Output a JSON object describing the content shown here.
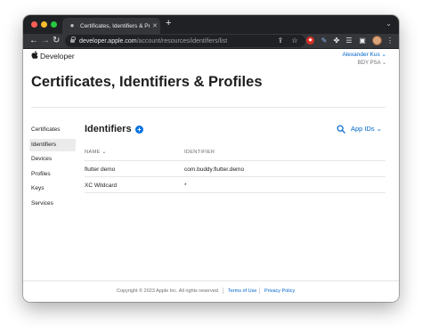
{
  "browser": {
    "tab_title": "Certificates, Identifiers & Profiles",
    "tab_close": "✕",
    "new_tab": "+",
    "tab_search": "⌄",
    "url_host": "developer.apple.com",
    "url_path": "/account/resources/identifiers/list"
  },
  "header": {
    "brand": "Developer",
    "user_name": "Alexander Kus ⌄",
    "team_name": "BDY PSA ⌄"
  },
  "page": {
    "title": "Certificates, Identifiers & Profiles"
  },
  "sidebar": {
    "items": [
      {
        "label": "Certificates",
        "active": false
      },
      {
        "label": "Identifiers",
        "active": true
      },
      {
        "label": "Devices",
        "active": false
      },
      {
        "label": "Profiles",
        "active": false
      },
      {
        "label": "Keys",
        "active": false
      },
      {
        "label": "Services",
        "active": false
      }
    ]
  },
  "main": {
    "section_title": "Identifiers",
    "add_label": "+",
    "filter_label": "App IDs ⌄",
    "columns": [
      "NAME ⌄",
      "IDENTIFIER"
    ],
    "rows": [
      {
        "name": "flutter demo",
        "identifier": "com.buddy.flutter.demo"
      },
      {
        "name": "XC Wildcard",
        "identifier": "*"
      }
    ]
  },
  "footer": {
    "copyright": "Copyright © 2023 Apple Inc. All rights reserved.",
    "terms": "Terms of Use",
    "privacy": "Privacy Policy"
  },
  "colors": {
    "link": "#0066cc",
    "accent": "#0071e3",
    "chrome_dark": "#202124",
    "chrome_toolbar": "#35363a"
  }
}
